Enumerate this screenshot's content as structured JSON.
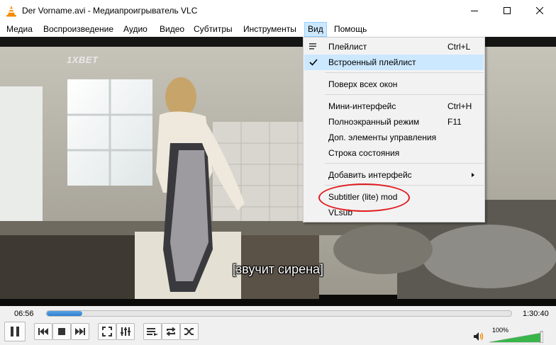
{
  "window": {
    "title": "Der Vorname.avi - Медиапроигрыватель VLC",
    "icons": {
      "app": "vlc-cone-icon",
      "minimize": "minimize-icon",
      "maximize": "maximize-icon",
      "close": "close-icon"
    }
  },
  "menubar": {
    "items": [
      {
        "label": "Медиа"
      },
      {
        "label": "Воспроизведение"
      },
      {
        "label": "Аудио"
      },
      {
        "label": "Видео"
      },
      {
        "label": "Субтитры"
      },
      {
        "label": "Инструменты"
      },
      {
        "label": "Вид",
        "active": true
      },
      {
        "label": "Помощь"
      }
    ]
  },
  "view_menu": {
    "items": [
      {
        "label": "Плейлист",
        "shortcut": "Ctrl+L",
        "icon": "playlist-icon"
      },
      {
        "label": "Встроенный плейлист",
        "shortcut": "",
        "icon": "checkmark-icon",
        "checked": true,
        "highlighted": true
      },
      {
        "label": "Поверх всех окон",
        "shortcut": ""
      },
      {
        "label": "Мини-интерфейс",
        "shortcut": "Ctrl+H"
      },
      {
        "label": "Полноэкранный режим",
        "shortcut": "F11"
      },
      {
        "label": "Доп. элементы управления",
        "shortcut": ""
      },
      {
        "label": "Строка состояния",
        "shortcut": ""
      },
      {
        "label": "Добавить интерфейс",
        "shortcut": "",
        "submenu": true
      },
      {
        "label": "Subtitler (lite) mod",
        "shortcut": "",
        "annotated": true
      },
      {
        "label": "VLsub",
        "shortcut": ""
      }
    ],
    "annotation_color": "#e2191d"
  },
  "video": {
    "watermark": "1XBET",
    "subtitle": "[звучит сирена]"
  },
  "playback": {
    "elapsed": "06:56",
    "total": "1:30:40",
    "progress_fraction": 0.0765,
    "volume_label": "100%",
    "volume_fraction": 1.0,
    "accent_color": "#2d7fd0"
  },
  "controls": {
    "buttons": [
      "pause-icon",
      "previous-icon",
      "stop-icon",
      "next-icon",
      "fullscreen-icon",
      "extended-settings-icon",
      "playlist-icon",
      "loop-icon",
      "shuffle-icon"
    ]
  }
}
